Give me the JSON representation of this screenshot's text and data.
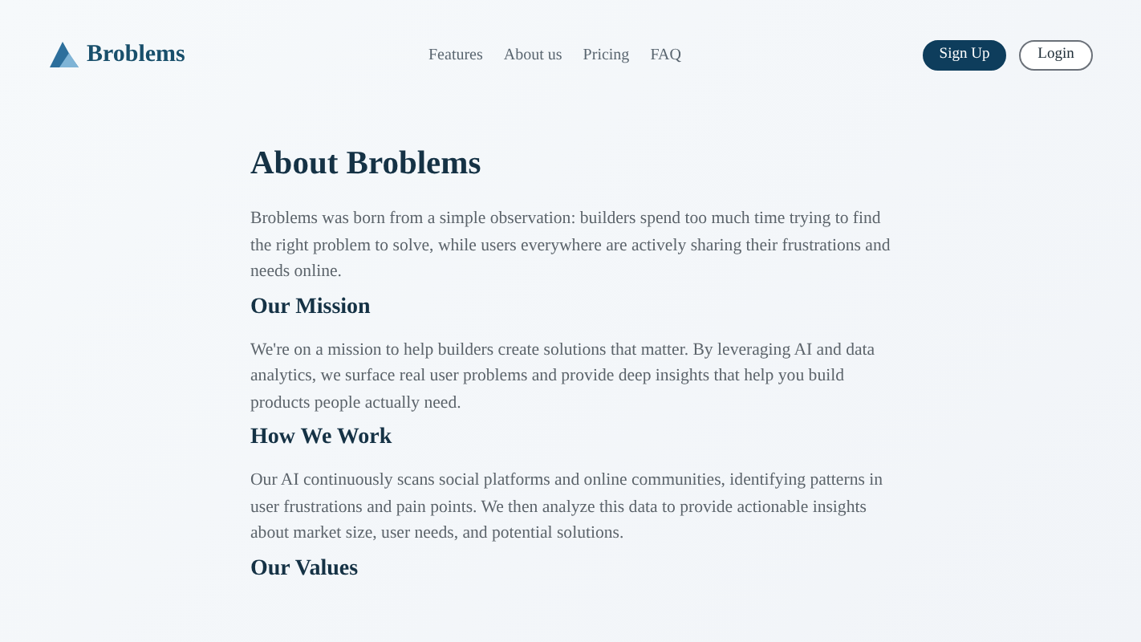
{
  "header": {
    "brand": "Broblems",
    "nav": [
      "Features",
      "About us",
      "Pricing",
      "FAQ"
    ],
    "signup": "Sign Up",
    "login": "Login"
  },
  "title": "About Broblems",
  "intro": "Broblems was born from a simple observation: builders spend too much time trying to find the right problem to solve, while users everywhere are actively sharing their frustrations and needs online.",
  "sections": [
    {
      "heading": "Our Mission",
      "text": "We're on a mission to help builders create solutions that matter. By leveraging AI and data analytics, we surface real user problems and provide deep insights that help you build products people actually need."
    },
    {
      "heading": "How We Work",
      "text": "Our AI continuously scans social platforms and online communities, identifying patterns in user frustrations and pain points. We then analyze this data to provide actionable insights about market size, user needs, and potential solutions."
    },
    {
      "heading": "Our Values"
    }
  ]
}
